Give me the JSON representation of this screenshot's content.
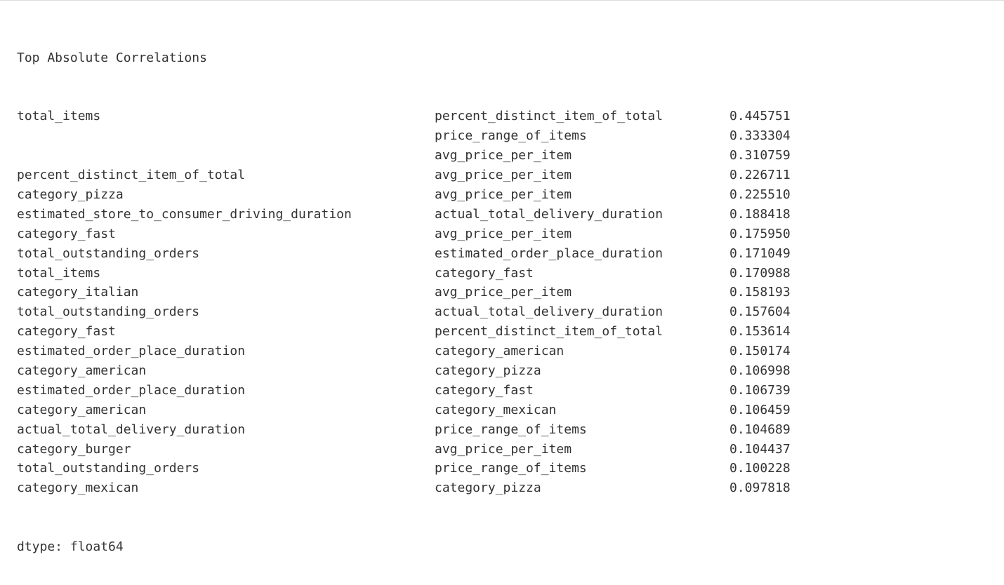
{
  "title": "Top Absolute Correlations",
  "rows": [
    {
      "c1": "total_items",
      "c2": "percent_distinct_item_of_total",
      "c3": "0.445751"
    },
    {
      "c1": "",
      "c2": "price_range_of_items",
      "c3": "0.333304"
    },
    {
      "c1": "",
      "c2": "avg_price_per_item",
      "c3": "0.310759"
    },
    {
      "c1": "percent_distinct_item_of_total",
      "c2": "avg_price_per_item",
      "c3": "0.226711"
    },
    {
      "c1": "category_pizza",
      "c2": "avg_price_per_item",
      "c3": "0.225510"
    },
    {
      "c1": "estimated_store_to_consumer_driving_duration",
      "c2": "actual_total_delivery_duration",
      "c3": "0.188418"
    },
    {
      "c1": "category_fast",
      "c2": "avg_price_per_item",
      "c3": "0.175950"
    },
    {
      "c1": "total_outstanding_orders",
      "c2": "estimated_order_place_duration",
      "c3": "0.171049"
    },
    {
      "c1": "total_items",
      "c2": "category_fast",
      "c3": "0.170988"
    },
    {
      "c1": "category_italian",
      "c2": "avg_price_per_item",
      "c3": "0.158193"
    },
    {
      "c1": "total_outstanding_orders",
      "c2": "actual_total_delivery_duration",
      "c3": "0.157604"
    },
    {
      "c1": "category_fast",
      "c2": "percent_distinct_item_of_total",
      "c3": "0.153614"
    },
    {
      "c1": "estimated_order_place_duration",
      "c2": "category_american",
      "c3": "0.150174"
    },
    {
      "c1": "category_american",
      "c2": "category_pizza",
      "c3": "0.106998"
    },
    {
      "c1": "estimated_order_place_duration",
      "c2": "category_fast",
      "c3": "0.106739"
    },
    {
      "c1": "category_american",
      "c2": "category_mexican",
      "c3": "0.106459"
    },
    {
      "c1": "actual_total_delivery_duration",
      "c2": "price_range_of_items",
      "c3": "0.104689"
    },
    {
      "c1": "category_burger",
      "c2": "avg_price_per_item",
      "c3": "0.104437"
    },
    {
      "c1": "total_outstanding_orders",
      "c2": "price_range_of_items",
      "c3": "0.100228"
    },
    {
      "c1": "category_mexican",
      "c2": "category_pizza",
      "c3": "0.097818"
    }
  ],
  "dtype": "dtype: float64"
}
